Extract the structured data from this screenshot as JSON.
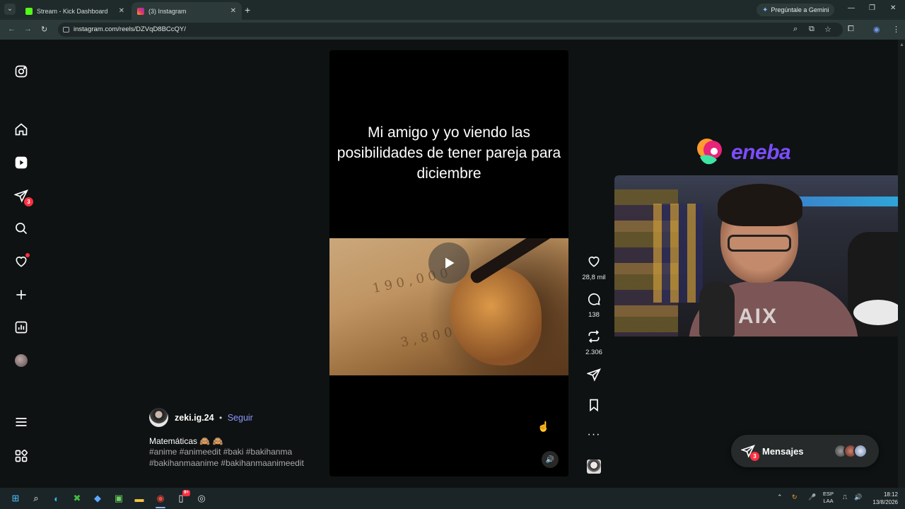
{
  "browser": {
    "tabs": [
      {
        "title": "Stream - Kick Dashboard",
        "favicon_color": "#53fc18",
        "active": false
      },
      {
        "title": "(3) Instagram",
        "favicon_color": "#e1306c",
        "active": true
      }
    ],
    "gemini_label": "Pregúntale a Gemini",
    "url": "instagram.com/reels/DZVqD8BCcQY/"
  },
  "sidebar": {
    "messages_badge": "3"
  },
  "reel": {
    "caption": "Mi amigo y yo viendo las posibilidades de tener pareja para diciembre",
    "frame_text_1": "1 9 0 , 0 0 0",
    "frame_text_2": "3 , 8 0 0"
  },
  "actions": {
    "likes": "28,8 mil",
    "comments": "138",
    "reposts": "2.306"
  },
  "author": {
    "username": "zeki.ig.24",
    "separator": "•",
    "follow_label": "Seguir",
    "description": "Matemáticas 🙈 🙈",
    "hashtags": "#anime #animeedit #baki #bakihanma #bakihanmaanime #bakihanmaanimeedit"
  },
  "overlay": {
    "brand": "eneba",
    "brand_color": "#7b4dff",
    "shirt_text": "AIX"
  },
  "messages": {
    "label": "Mensajes",
    "badge": "3"
  },
  "taskbar": {
    "lang_top": "ESP",
    "lang_bottom": "LAA",
    "time": "18:12",
    "date": "13/8/2026",
    "notif_badge": "9+"
  },
  "colors": {
    "accent_link": "#8a97ff",
    "notification": "#ff3040"
  }
}
